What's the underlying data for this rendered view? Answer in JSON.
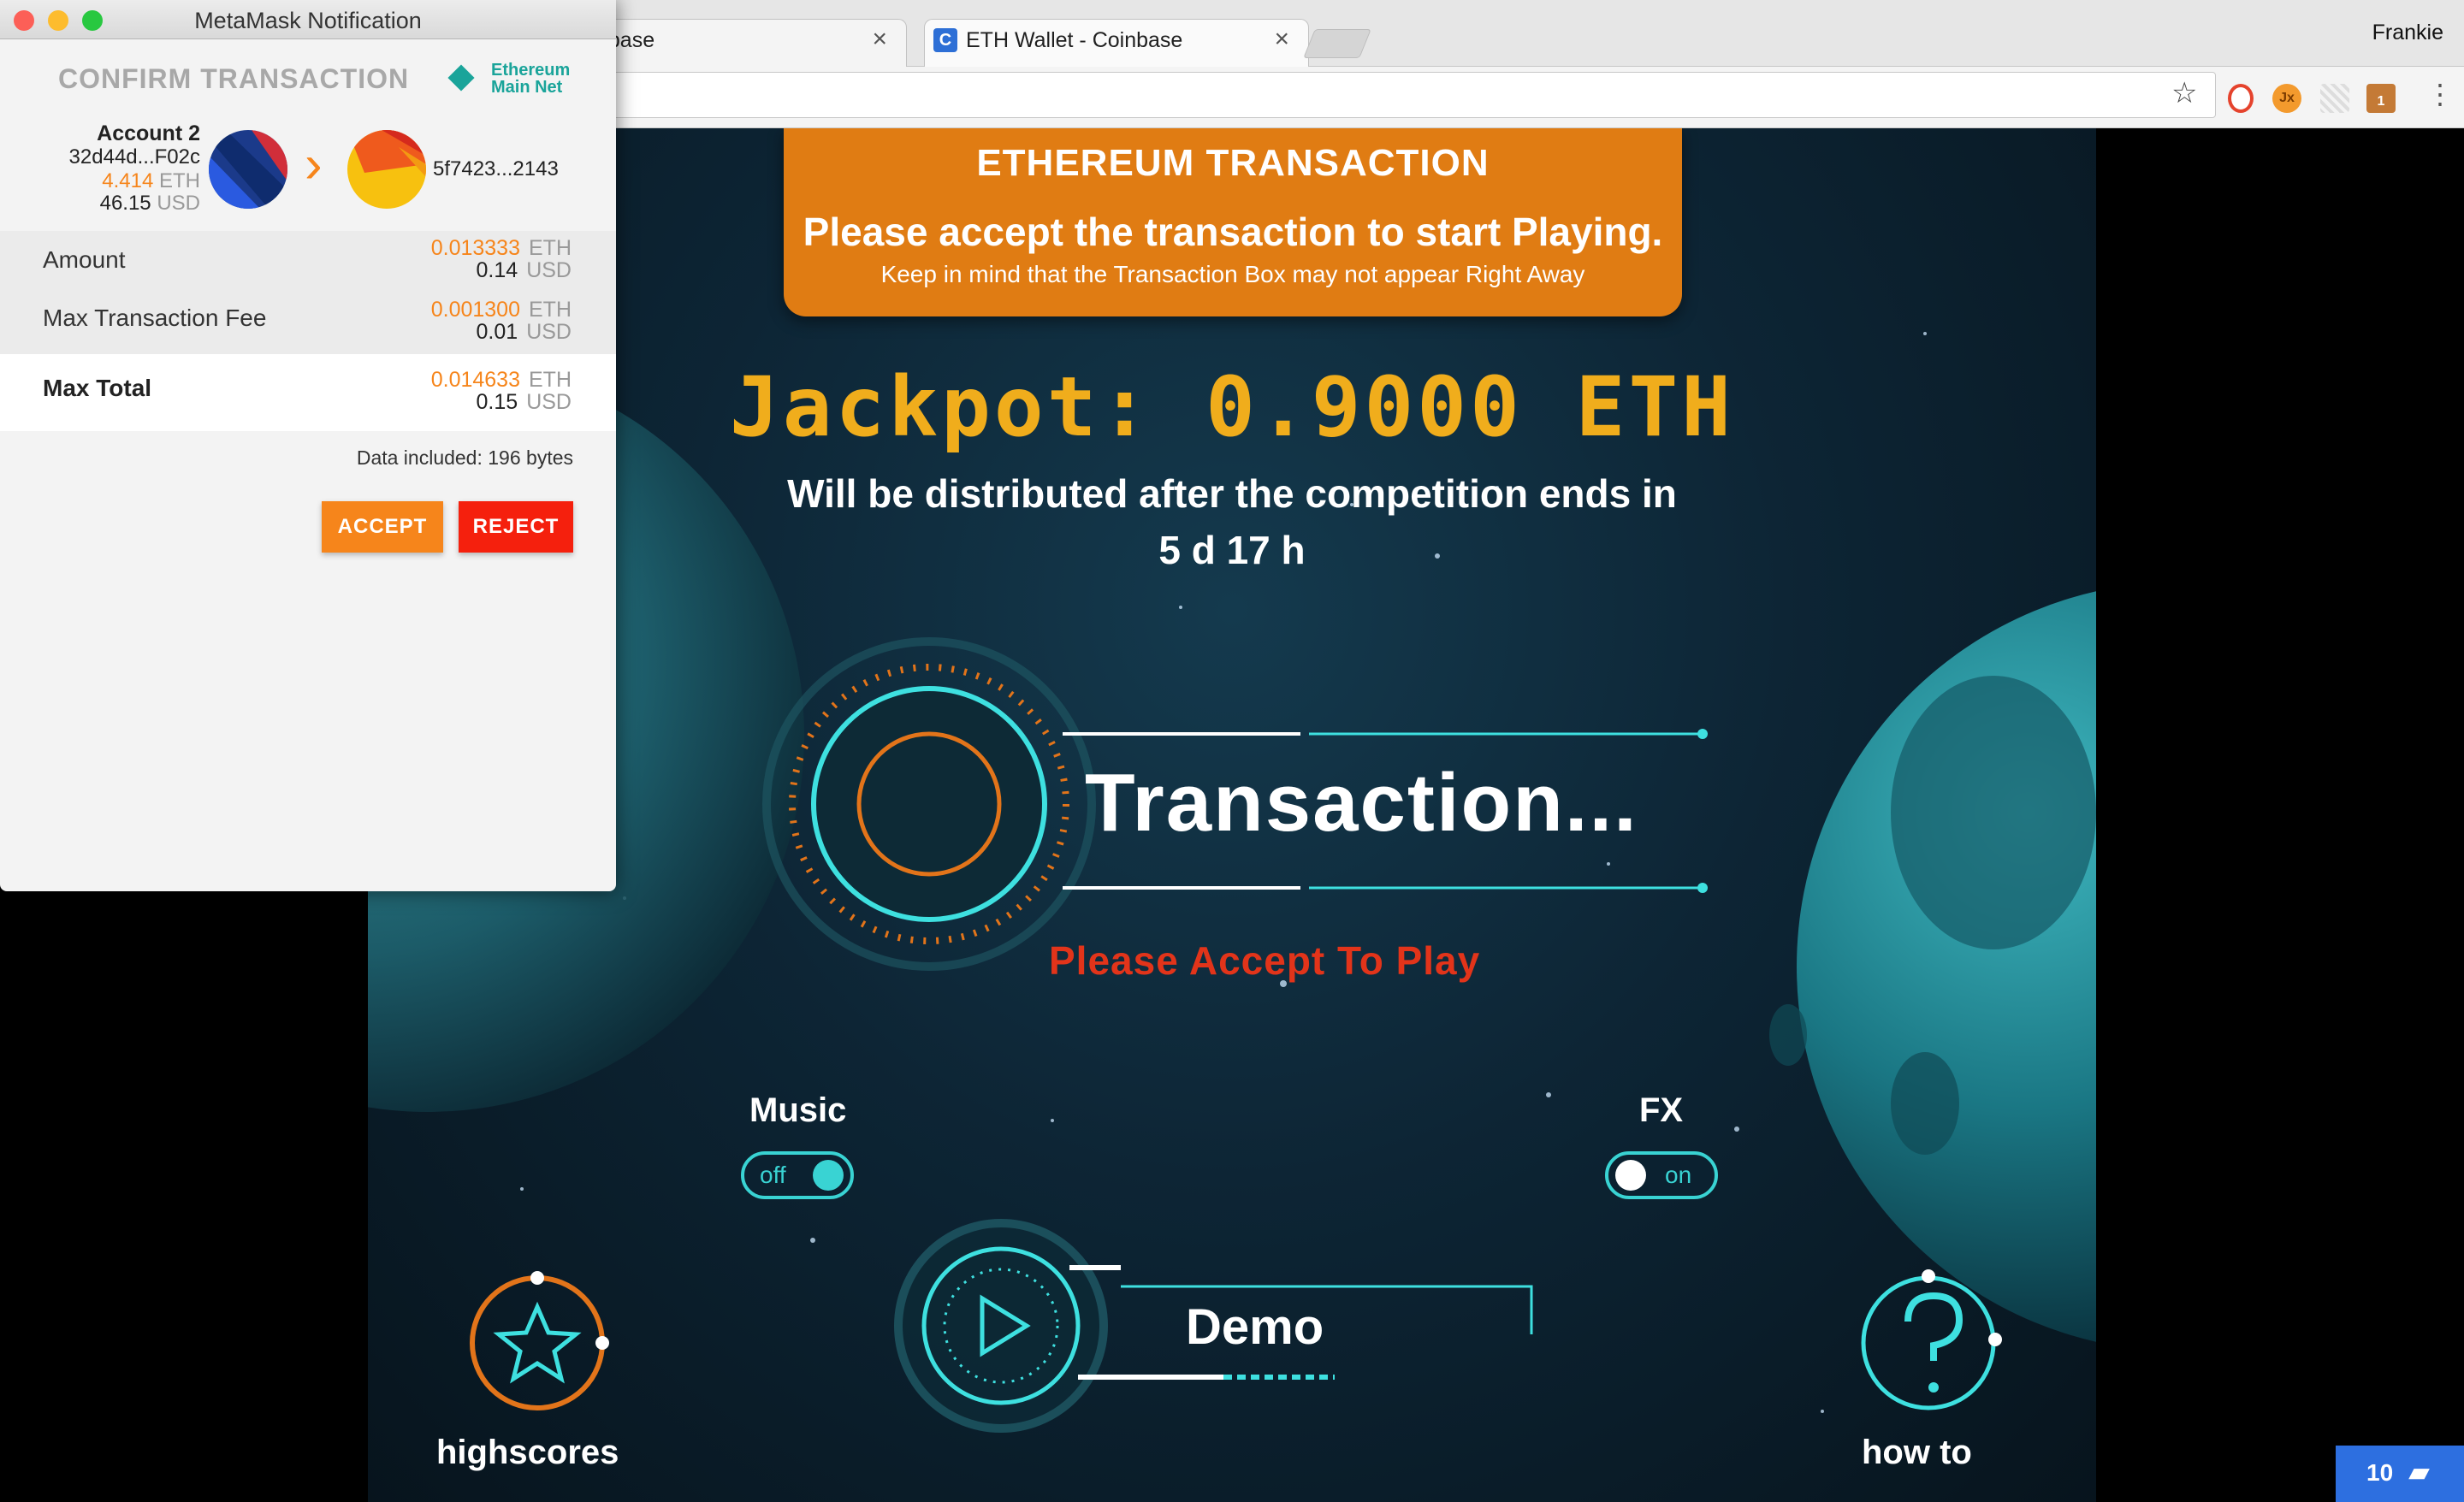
{
  "browser": {
    "tabs": [
      {
        "label": "nbase"
      },
      {
        "label": "ETH Wallet - Coinbase",
        "favicon": "C"
      }
    ],
    "profile_name": "Frankie",
    "extensions": [
      {
        "name": "opera-icon"
      },
      {
        "name": "jx-extension-icon",
        "text": "Jx"
      },
      {
        "name": "grid-extension-icon"
      },
      {
        "name": "notification-extension-icon",
        "text": "1"
      }
    ]
  },
  "metamask": {
    "window_title": "MetaMask Notification",
    "heading": "CONFIRM TRANSACTION",
    "network_line1": "Ethereum",
    "network_line2": "Main Net",
    "from": {
      "name": "Account 2",
      "address": "32d44d...F02c",
      "eth_value": "4.414",
      "eth_unit": "ETH",
      "usd_value": "46.15",
      "usd_unit": "USD"
    },
    "to_address": "5f7423...2143",
    "rows": {
      "amount": {
        "label": "Amount",
        "eth": "0.013333",
        "eth_unit": "ETH",
        "usd": "0.14",
        "usd_unit": "USD"
      },
      "fee": {
        "label": "Max Transaction Fee",
        "eth": "0.001300",
        "eth_unit": "ETH",
        "usd": "0.01",
        "usd_unit": "USD"
      },
      "total": {
        "label": "Max Total",
        "eth": "0.014633",
        "eth_unit": "ETH",
        "usd": "0.15",
        "usd_unit": "USD"
      }
    },
    "data_included": "Data included: 196 bytes",
    "accept_label": "ACCEPT",
    "reject_label": "REJECT"
  },
  "game": {
    "banner_title": "ETHEREUM TRANSACTION",
    "banner_main": "Please accept the transaction to start Playing.",
    "banner_sub": "Keep in mind that the Transaction Box may not appear Right Away",
    "jackpot": "Jackpot: 0.9000 ETH",
    "distribution": "Will be distributed after the competition ends in",
    "countdown": "5 d 17 h",
    "transaction": "Transaction...",
    "please_accept": "Please Accept To Play",
    "music_label": "Music",
    "music_state": "off",
    "fx_label": "FX",
    "fx_state": "on",
    "demo_label": "Demo",
    "highscores_label": "highscores",
    "howto_label": "how to"
  },
  "chat_badge": {
    "count": "10"
  },
  "colors": {
    "metamask_orange": "#f6851b",
    "reject_red": "#f5200d",
    "game_teal": "#39d3d3",
    "banner_orange": "#e07c13",
    "jackpot_gold": "#f0ad1c",
    "alert_red": "#e2341a"
  }
}
